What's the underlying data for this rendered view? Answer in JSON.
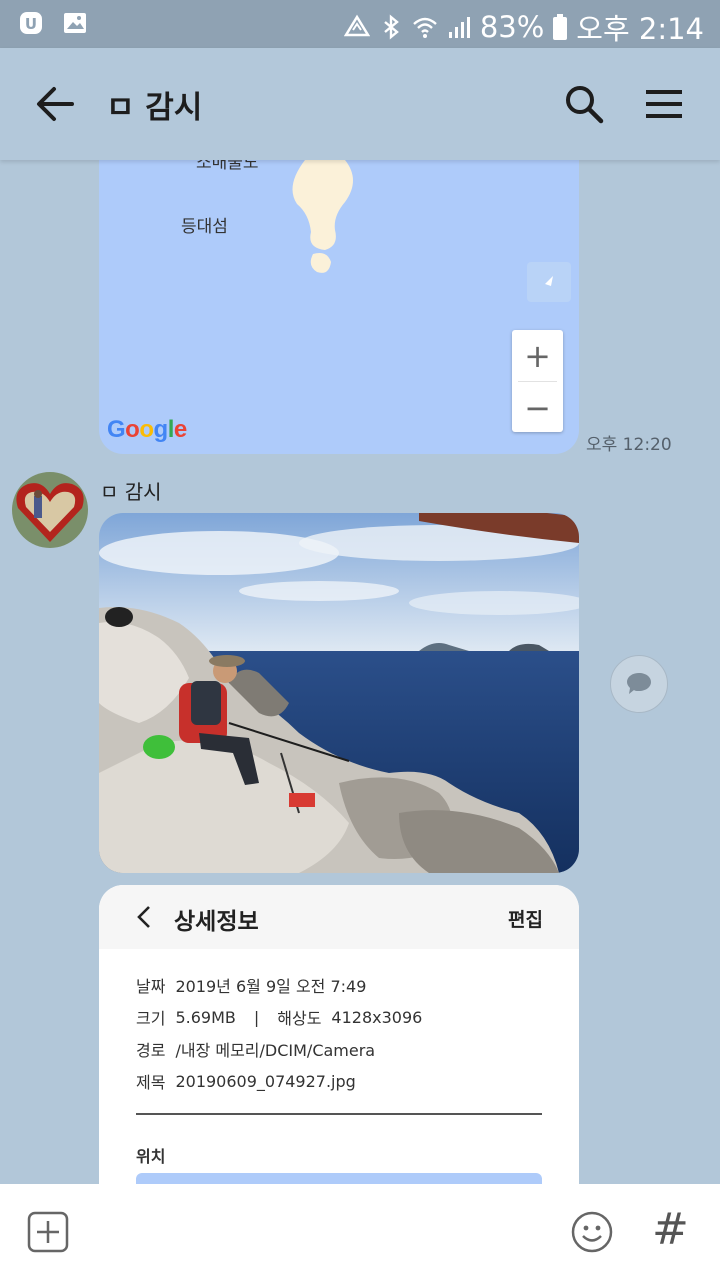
{
  "status_bar": {
    "battery": "83%",
    "time": "오후 2:14",
    "icons": [
      "app-notification-icon",
      "gallery-icon",
      "data-saver-icon",
      "bluetooth-icon",
      "wifi-icon",
      "signal-icon",
      "battery-icon"
    ]
  },
  "header": {
    "title": "ㅁ 감시",
    "icons": [
      "back-arrow-icon",
      "search-icon",
      "menu-icon"
    ]
  },
  "map_message": {
    "label_top": "소매물도",
    "label_island": "등대섬",
    "zoom_in": "+",
    "zoom_out": "−",
    "google": "Google",
    "time": "오후 12:20"
  },
  "photo_message": {
    "sender": "ㅁ 감시"
  },
  "info_card": {
    "title": "상세정보",
    "edit": "편집",
    "date_label": "날짜",
    "date_value": "2019년 6월 9일 오전 7:49",
    "size_label": "크기",
    "size_value": "5.69MB",
    "separator": "|",
    "resolution_label": "해상도",
    "resolution_value": "4128x3096",
    "path_label": "경로",
    "path_value": "/내장 메모리/DCIM/Camera",
    "name_label": "제목",
    "name_value": "20190609_074927.jpg",
    "location_label": "위치"
  },
  "input_bar": {
    "hash": "#"
  },
  "colors": {
    "chat_background": "#b2c7d9",
    "map_water": "#aecbfa",
    "input_bar": "#ffffff"
  }
}
